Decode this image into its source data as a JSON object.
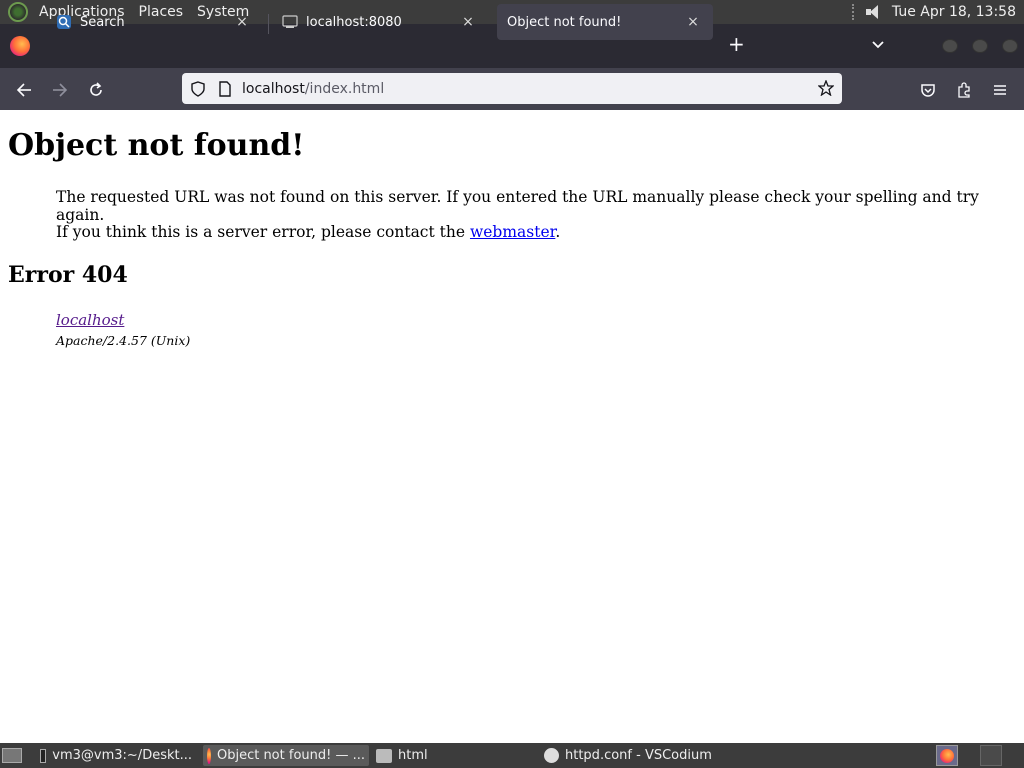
{
  "top_panel": {
    "menus": [
      "Applications",
      "Places",
      "System"
    ],
    "clock": "Tue Apr 18, 13:58"
  },
  "tabs": [
    {
      "title": "Search",
      "close": "×"
    },
    {
      "title": "localhost:8080",
      "close": "×"
    },
    {
      "title": "Object not found!",
      "close": "×"
    }
  ],
  "toolbar": {
    "new_tab": "+",
    "url_host": "localhost",
    "url_path": "/index.html"
  },
  "page": {
    "heading": "Object not found!",
    "message": "The requested URL was not found on this server. If you entered the URL manually please check your spelling and try again.",
    "contact_prefix": "If you think this is a server error, please contact the ",
    "contact_link": "webmaster",
    "contact_suffix": ".",
    "error_title": "Error 404",
    "address_link": "localhost",
    "server_signature": "Apache/2.4.57 (Unix)"
  },
  "taskbar": {
    "items": [
      {
        "label": "vm3@vm3:~/Deskt..."
      },
      {
        "label": "Object not found! — ..."
      },
      {
        "label": "html"
      },
      {
        "label": "httpd.conf - VSCodium"
      }
    ]
  },
  "colors": {
    "panel_bg": "#3c3c3c",
    "tabbar_bg": "#2b2a33",
    "toolbar_bg": "#42414d",
    "link": "#0000ee",
    "visited_link": "#551a8b"
  }
}
